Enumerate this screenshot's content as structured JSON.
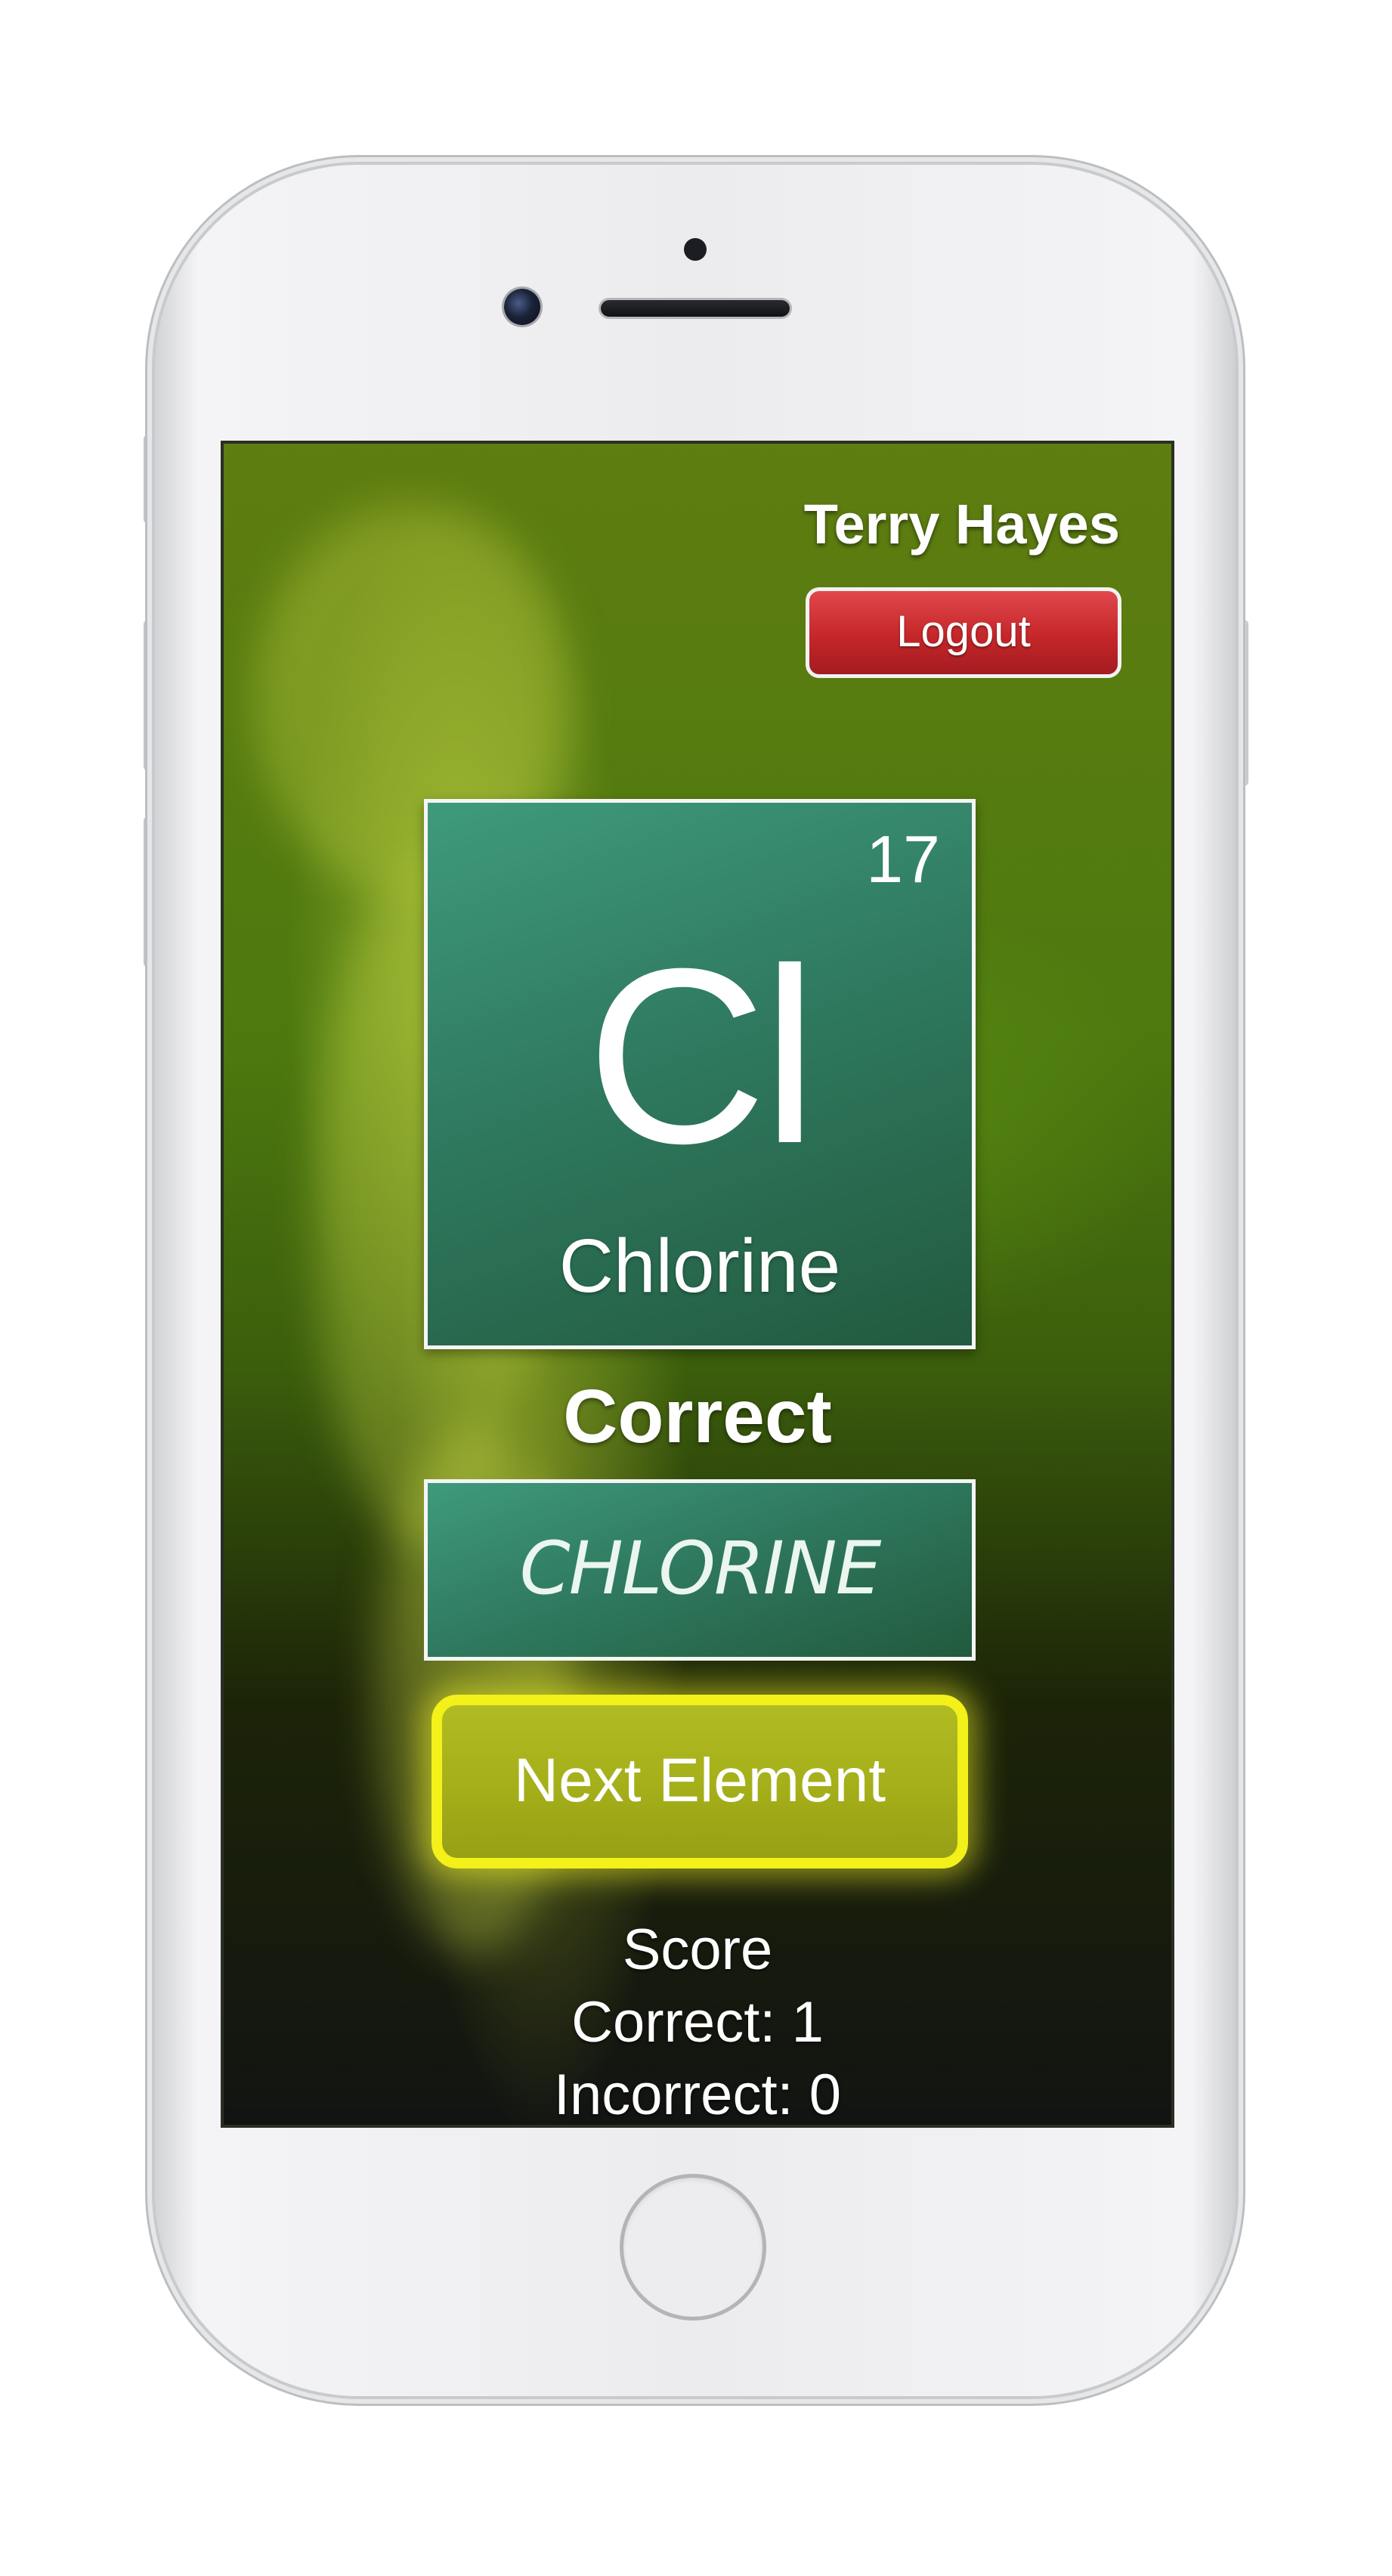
{
  "header": {
    "user_name": "Terry Hayes",
    "logout_label": "Logout"
  },
  "element": {
    "atomic_number": "17",
    "symbol": "Cl",
    "name": "Chlorine"
  },
  "result": {
    "label": "Correct",
    "answer": "CHLORINE"
  },
  "actions": {
    "next_label": "Next Element"
  },
  "score": {
    "title": "Score",
    "correct_label": "Correct:",
    "correct_value": "1",
    "incorrect_label": "Incorrect:",
    "incorrect_value": "0"
  },
  "colors": {
    "tile": "#2f7a60",
    "logout": "#c5262a",
    "next_button": "#a5b01a",
    "next_glow": "#f3f01a"
  }
}
